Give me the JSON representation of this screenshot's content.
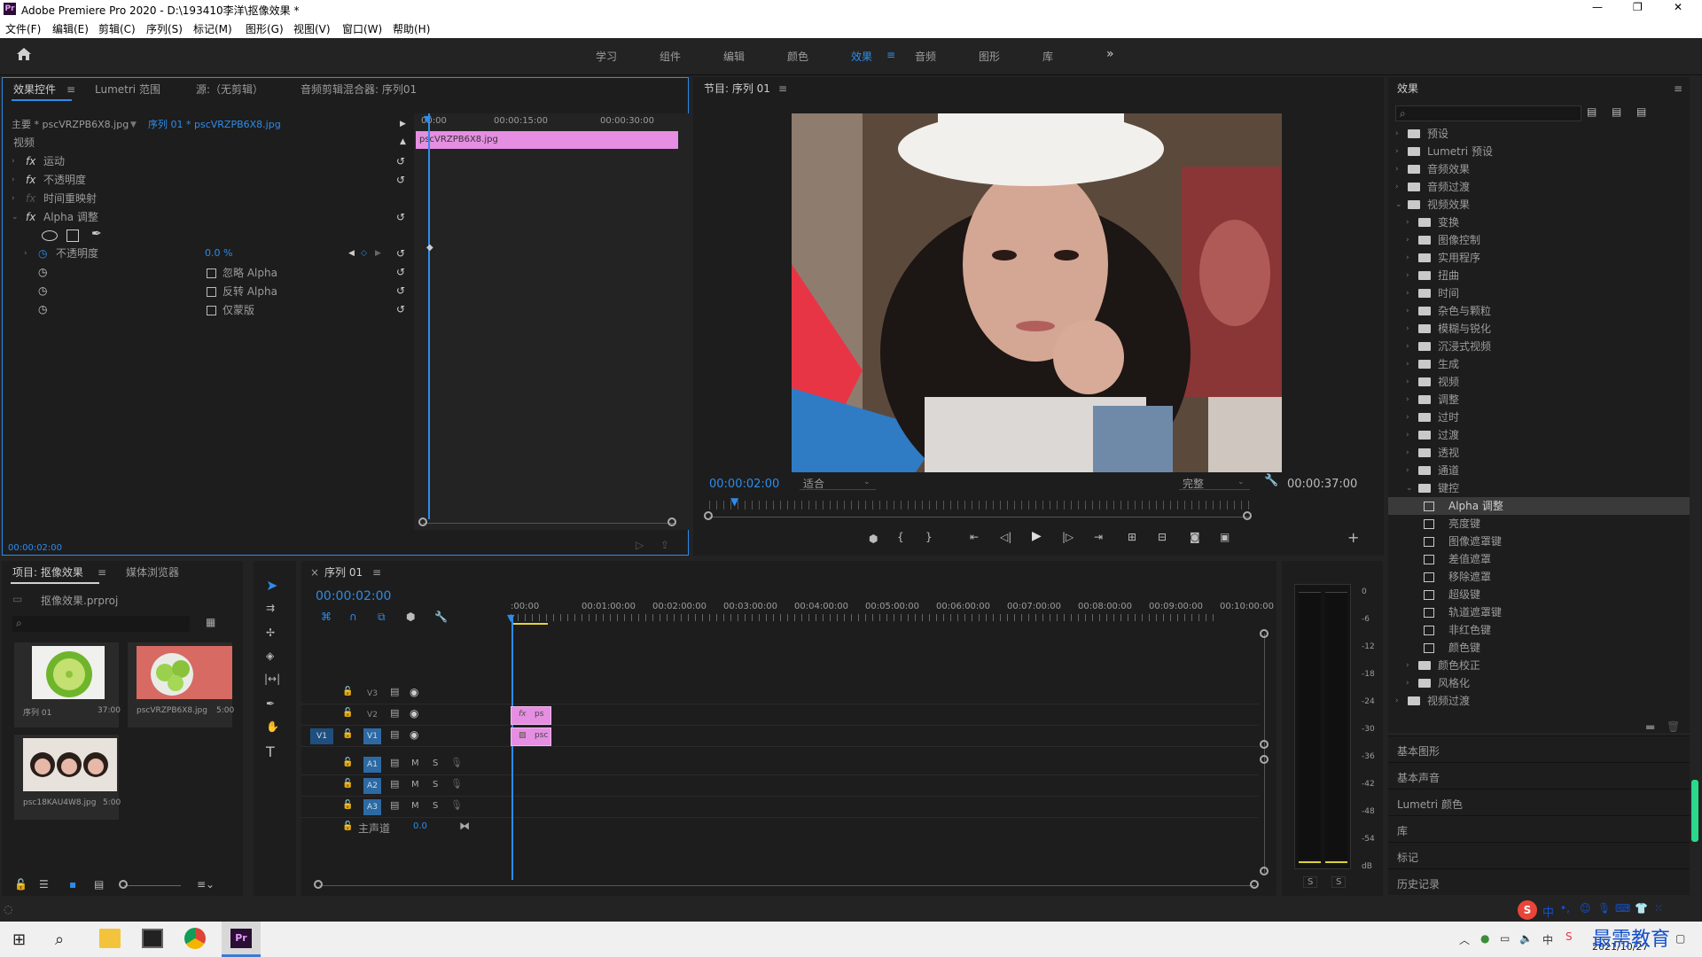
{
  "window": {
    "title": "Adobe Premiere Pro 2020 - D:\\193410李洋\\抠像效果 *",
    "app_badge": "Pr",
    "controls": [
      "—",
      "❐",
      "✕"
    ]
  },
  "menu": [
    "文件(F)",
    "编辑(E)",
    "剪辑(C)",
    "序列(S)",
    "标记(M)",
    "图形(G)",
    "视图(V)",
    "窗口(W)",
    "帮助(H)"
  ],
  "workspaces": {
    "items": [
      "学习",
      "组件",
      "编辑",
      "颜色",
      "效果",
      "音频",
      "图形",
      "库"
    ],
    "active": "效果",
    "more": "»"
  },
  "effect_controls": {
    "tabs": [
      "效果控件",
      "Lumetri 范围",
      "源:（无剪辑）",
      "音频剪辑混合器: 序列01"
    ],
    "master": "主要 * pscVRZPB6X8.jpg",
    "sequence": "序列 01 * pscVRZPB6X8.jpg",
    "ruler": [
      "00:00",
      "00:00:15:00",
      "00:00:30:00"
    ],
    "clip_name": "pscVRZPB6X8.jpg",
    "section": "视频",
    "fx_rows": [
      "运动",
      "不透明度",
      "时间重映射",
      "Alpha 调整"
    ],
    "param_opacity_label": "不透明度",
    "param_opacity_value": "0.0 %",
    "checkboxes": [
      "忽略 Alpha",
      "反转 Alpha",
      "仅蒙版"
    ],
    "fx_label": "fx",
    "timecode": "00:00:02:00"
  },
  "program": {
    "title": "节目: 序列 01",
    "timecode": "00:00:02:00",
    "fit": "适合",
    "quality": "完整",
    "duration": "00:00:37:00"
  },
  "project": {
    "tabs": [
      "项目: 抠像效果",
      "媒体浏览器"
    ],
    "file": "抠像效果.prproj",
    "items": [
      {
        "name": "序列 01",
        "dur": "37:00"
      },
      {
        "name": "pscVRZPB6X8.jpg",
        "dur": "5:00"
      },
      {
        "name": "psc18KAU4W8.jpg",
        "dur": "5:00"
      }
    ]
  },
  "timeline": {
    "tab": "序列 01",
    "timecode": "00:00:02:00",
    "ruler": [
      ":00:00",
      "00:01:00:00",
      "00:02:00:00",
      "00:03:00:00",
      "00:04:00:00",
      "00:05:00:00",
      "00:06:00:00",
      "00:07:00:00",
      "00:08:00:00",
      "00:09:00:00",
      "00:10:00:00"
    ],
    "video_tracks": [
      "V3",
      "V2",
      "V1"
    ],
    "audio_tracks": [
      "A1",
      "A2",
      "A3"
    ],
    "source_patch": "V1",
    "master_label": "主声道",
    "master_value": "0.0",
    "mute": "M",
    "solo": "S",
    "clip_v2": "ps",
    "clip_v1": "psc"
  },
  "audio_meter": {
    "labels": [
      "0",
      "-6",
      "-12",
      "-18",
      "-24",
      "-30",
      "-36",
      "-42",
      "-48",
      "-54",
      "dB"
    ],
    "solo": [
      "S",
      "S"
    ]
  },
  "effects": {
    "title": "效果",
    "tree": [
      {
        "label": "预设",
        "level": 0
      },
      {
        "label": "Lumetri 预设",
        "level": 0
      },
      {
        "label": "音频效果",
        "level": 0
      },
      {
        "label": "音频过渡",
        "level": 0
      },
      {
        "label": "视频效果",
        "level": 0,
        "open": true
      },
      {
        "label": "变换",
        "level": 1
      },
      {
        "label": "图像控制",
        "level": 1
      },
      {
        "label": "实用程序",
        "level": 1
      },
      {
        "label": "扭曲",
        "level": 1
      },
      {
        "label": "时间",
        "level": 1
      },
      {
        "label": "杂色与颗粒",
        "level": 1
      },
      {
        "label": "模糊与锐化",
        "level": 1
      },
      {
        "label": "沉浸式视频",
        "level": 1
      },
      {
        "label": "生成",
        "level": 1
      },
      {
        "label": "视频",
        "level": 1
      },
      {
        "label": "调整",
        "level": 1
      },
      {
        "label": "过时",
        "level": 1
      },
      {
        "label": "过渡",
        "level": 1
      },
      {
        "label": "透视",
        "level": 1
      },
      {
        "label": "通道",
        "level": 1
      },
      {
        "label": "键控",
        "level": 1,
        "open": true
      },
      {
        "label": "Alpha 调整",
        "level": 2,
        "selected": true
      },
      {
        "label": "亮度键",
        "level": 2
      },
      {
        "label": "图像遮罩键",
        "level": 2
      },
      {
        "label": "差值遮罩",
        "level": 2
      },
      {
        "label": "移除遮罩",
        "level": 2
      },
      {
        "label": "超级键",
        "level": 2
      },
      {
        "label": "轨道遮罩键",
        "level": 2
      },
      {
        "label": "非红色键",
        "level": 2
      },
      {
        "label": "颜色键",
        "level": 2
      },
      {
        "label": "颜色校正",
        "level": 1
      },
      {
        "label": "风格化",
        "level": 1
      },
      {
        "label": "视频过渡",
        "level": 0
      }
    ],
    "panels": [
      "基本图形",
      "基本声音",
      "Lumetri 颜色",
      "库",
      "标记",
      "历史记录"
    ]
  },
  "taskbar": {
    "time": "",
    "date": "2021/10/27",
    "ime": "中",
    "watermark": "最需教育"
  },
  "colors": {
    "accent": "#2d8ceb",
    "clip": "#e58ee2",
    "panel": "#1d1d1d"
  }
}
